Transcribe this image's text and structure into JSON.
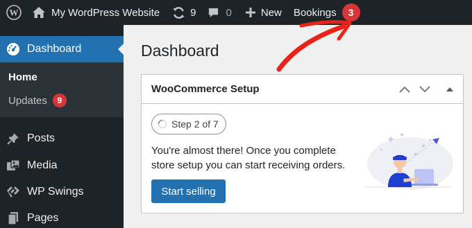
{
  "adminbar": {
    "site_label": "My WordPress Website",
    "updates_count": "9",
    "comments_count": "0",
    "new_label": "New",
    "bookings_label": "Bookings",
    "bookings_badge": "3"
  },
  "sidebar": {
    "active_item": "Dashboard",
    "submenu": {
      "home": "Home",
      "updates": "Updates",
      "updates_badge": "9"
    },
    "items": [
      {
        "label": "Posts",
        "icon": "pin-icon"
      },
      {
        "label": "Media",
        "icon": "media-icon"
      },
      {
        "label": "WP Swings",
        "icon": "wpswings-icon"
      },
      {
        "label": "Pages",
        "icon": "pages-icon"
      }
    ]
  },
  "main": {
    "page_title": "Dashboard",
    "panel": {
      "title": "WooCommerce Setup",
      "step": "Step 2 of 7",
      "message": "You're almost there! Once you complete store setup you can start receiving orders.",
      "button": "Start selling"
    }
  },
  "colors": {
    "adminbar_bg": "#1d2327",
    "accent": "#2271b1",
    "badge_red": "#d63638",
    "annotation_arrow": "#e8231a"
  }
}
